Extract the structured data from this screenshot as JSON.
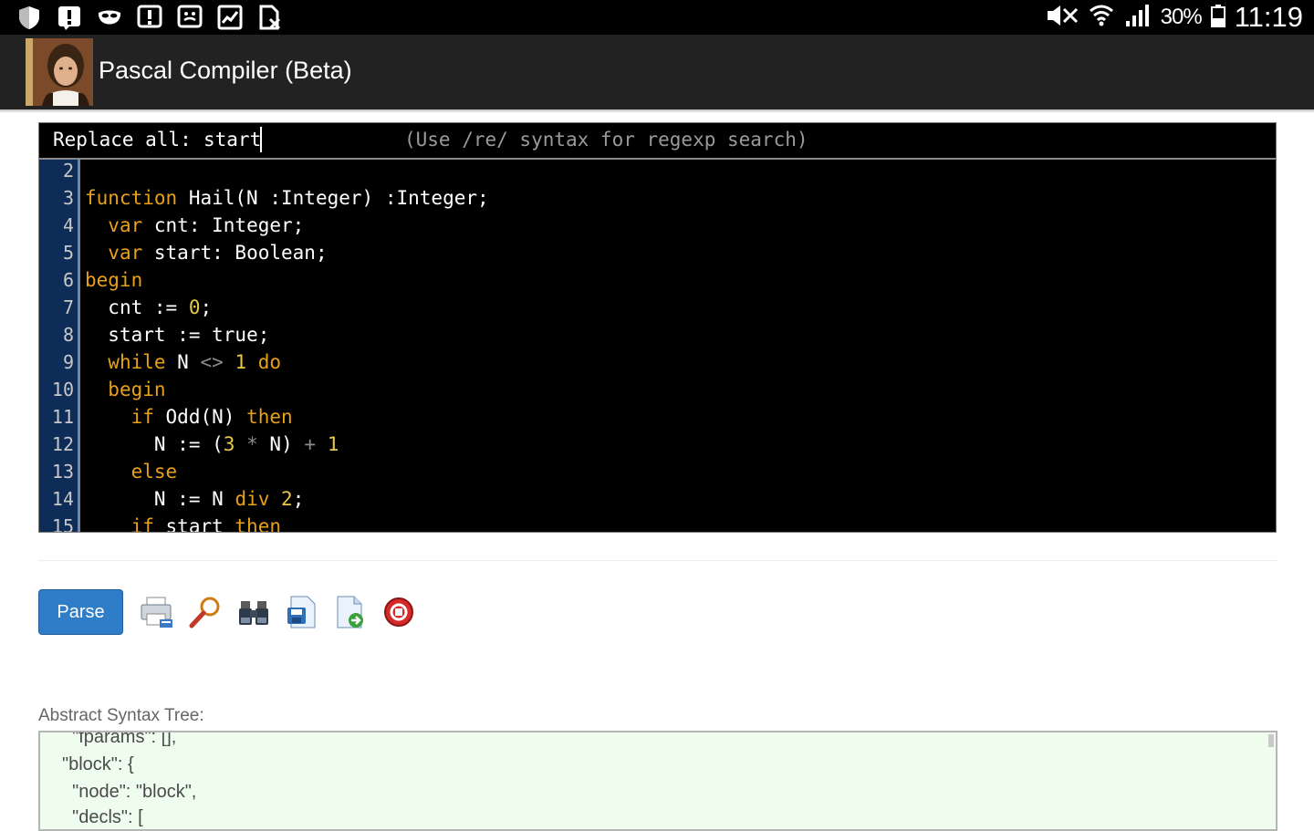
{
  "status_bar": {
    "left_icons": [
      "shield-icon",
      "alert-icon",
      "mask-icon",
      "alert-icon",
      "face-icon",
      "chart-icon",
      "document-x-icon"
    ],
    "battery_text": "30%",
    "clock": "11:19"
  },
  "app_bar": {
    "title": "Pascal Compiler (Beta)",
    "icon": "pascal-portrait-icon"
  },
  "editor": {
    "dialog": {
      "label": "Replace all:",
      "value": "start",
      "hint": "(Use /re/ syntax for regexp search)"
    },
    "lines": [
      {
        "n": "2",
        "text": ""
      },
      {
        "n": "3",
        "text": "function Hail(N :Integer) :Integer;"
      },
      {
        "n": "4",
        "text": "  var cnt: Integer;"
      },
      {
        "n": "5",
        "text": "  var start: Boolean;"
      },
      {
        "n": "6",
        "text": "begin"
      },
      {
        "n": "7",
        "text": "  cnt := 0;"
      },
      {
        "n": "8",
        "text": "  start := true;"
      },
      {
        "n": "9",
        "text": "  while N <> 1 do"
      },
      {
        "n": "10",
        "text": "  begin"
      },
      {
        "n": "11",
        "text": "    if Odd(N) then"
      },
      {
        "n": "12",
        "text": "      N := (3 * N) + 1"
      },
      {
        "n": "13",
        "text": "    else"
      },
      {
        "n": "14",
        "text": "      N := N div 2;"
      },
      {
        "n": "15",
        "text": "    if start then"
      }
    ],
    "colors": {
      "keyword": "#e8a017",
      "number": "#e8c84a",
      "operator": "#8a8a8a",
      "gutter": "#0e2c58"
    }
  },
  "toolbar": {
    "parse_label": "Parse",
    "tools": [
      "print-icon",
      "search-icon",
      "binoculars-icon",
      "save-document-icon",
      "export-document-icon",
      "stop-icon"
    ]
  },
  "ast": {
    "label": "Abstract Syntax Tree:",
    "lines": [
      "  \"fparams\": [],",
      "\"block\": {",
      "  \"node\": \"block\",",
      "  \"decls\": ["
    ]
  }
}
